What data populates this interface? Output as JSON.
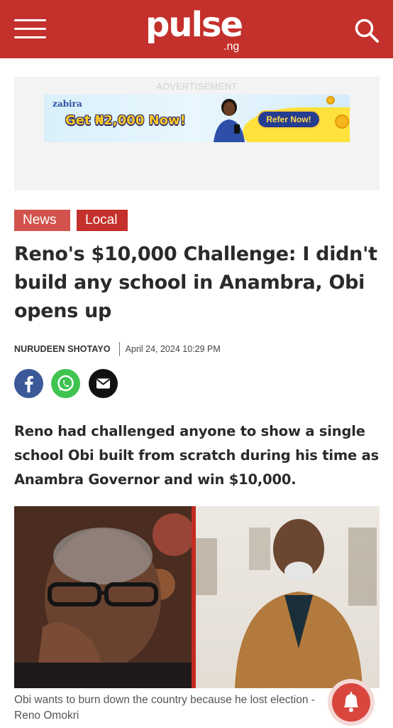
{
  "header": {
    "logo_word": "pulse",
    "logo_tld": ".ng",
    "menu_icon": "hamburger-icon",
    "search_icon": "search-icon",
    "bg_color": "#c4302b"
  },
  "ad": {
    "label": "ADVERTISEMENT",
    "brand": "zabira",
    "headline": "Get ₦2,000 Now!",
    "cta": "Refer Now!"
  },
  "tags": [
    "News",
    "Local"
  ],
  "article": {
    "headline": "Reno's $10,000 Challenge: I didn't build any school in Anambra, Obi opens up",
    "author": "NURUDEEN SHOTAYO",
    "date": "April 24, 2024 10:29 PM",
    "summary": "Reno had challenged anyone to show a single school Obi built from scratch during his time as Anambra Governor and win $10,000.",
    "caption": "Obi wants to burn down the country because he lost election - Reno Omokri"
  },
  "share": [
    {
      "name": "facebook",
      "icon": "facebook-icon",
      "color": "#3b5898"
    },
    {
      "name": "whatsapp",
      "icon": "whatsapp-icon",
      "color": "#40c351"
    },
    {
      "name": "email",
      "icon": "mail-icon",
      "color": "#111111"
    }
  ],
  "notify": {
    "icon": "bell-icon",
    "color": "#d8463e"
  }
}
